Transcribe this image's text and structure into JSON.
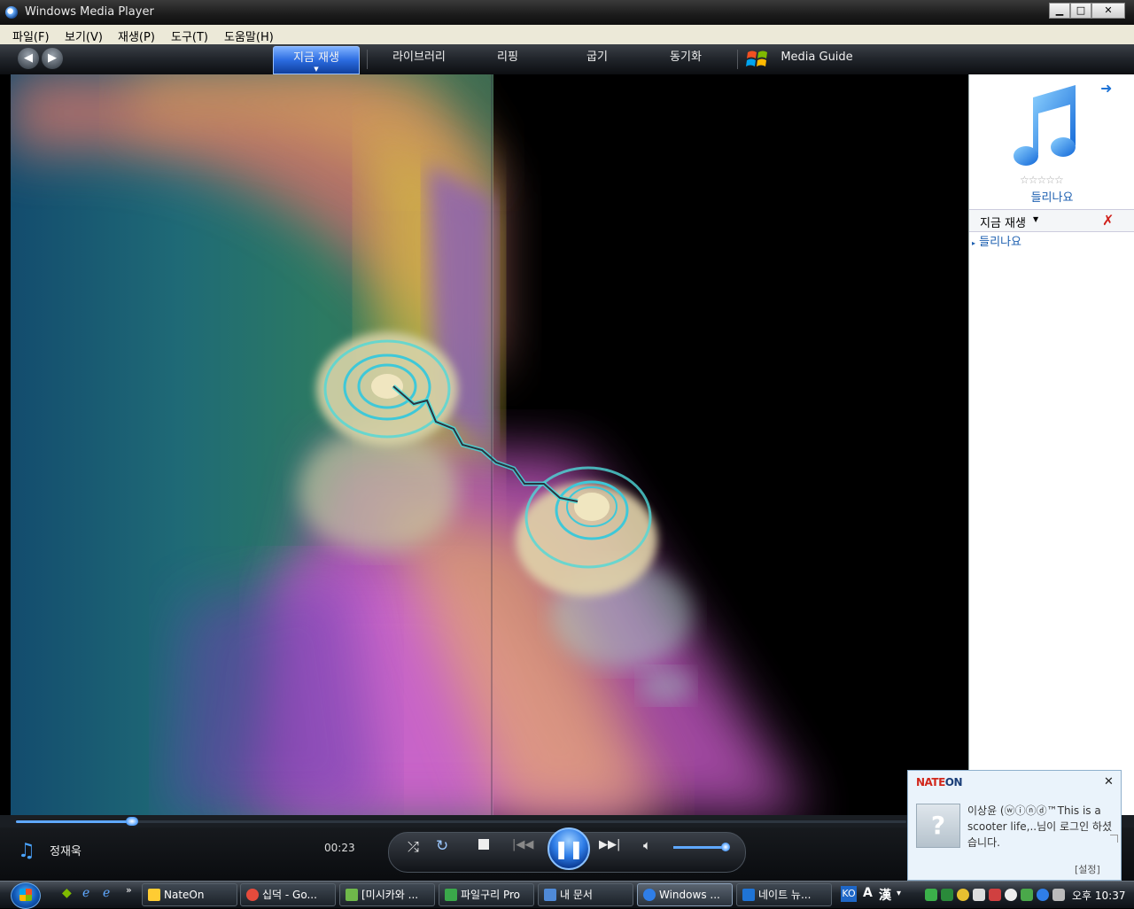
{
  "window": {
    "title": "Windows Media Player"
  },
  "menu": [
    "파일(F)",
    "보기(V)",
    "재생(P)",
    "도구(T)",
    "도움말(H)"
  ],
  "nav": {
    "tabs": [
      {
        "label": "지금 재생",
        "active": true
      },
      {
        "label": "라이브러리",
        "active": false
      },
      {
        "label": "리핑",
        "active": false
      },
      {
        "label": "굽기",
        "active": false
      },
      {
        "label": "동기화",
        "active": false
      }
    ],
    "guide_label": "Media Guide"
  },
  "now_playing": {
    "album_title": "들리나요",
    "rating_stars": 0,
    "list_header": "지금 재생",
    "list_items": [
      "들리나요"
    ]
  },
  "player": {
    "track_name": "정재욱",
    "elapsed": "00:23",
    "seek_fraction": 0.13,
    "volume_fraction": 0.95,
    "state": "playing"
  },
  "toast": {
    "brand_red": "NATE",
    "brand_blue": "ON",
    "message": "이상윤 (ⓦⓘⓝⓓ™This is a scooter life,..님이 로그인 하셨습니다.",
    "settings_label": "[설정]"
  },
  "taskbar": {
    "tasks": [
      {
        "label": "NateOn",
        "icon_color": "#ffcc33",
        "active": false
      },
      {
        "label": "십덕 - Go...",
        "icon_color": "#e64b3c",
        "active": false
      },
      {
        "label": "[미시카와 ...",
        "icon_color": "#6fb84a",
        "active": false
      },
      {
        "label": "파일구리 Pro",
        "icon_color": "#3aa84a",
        "active": false
      },
      {
        "label": "내 문서",
        "icon_color": "#4f8ad8",
        "active": false
      },
      {
        "label": "Windows ...",
        "icon_color": "#2f7ee8",
        "active": true
      },
      {
        "label": "네이트 뉴...",
        "icon_color": "#1f74d6",
        "active": false
      }
    ],
    "ime_lang": "KO",
    "ime_a": "A",
    "ime_han": "漢",
    "clock": "오후 10:37"
  },
  "colors": {
    "accent": "#2f7ee8",
    "brand": "#d1271b"
  }
}
